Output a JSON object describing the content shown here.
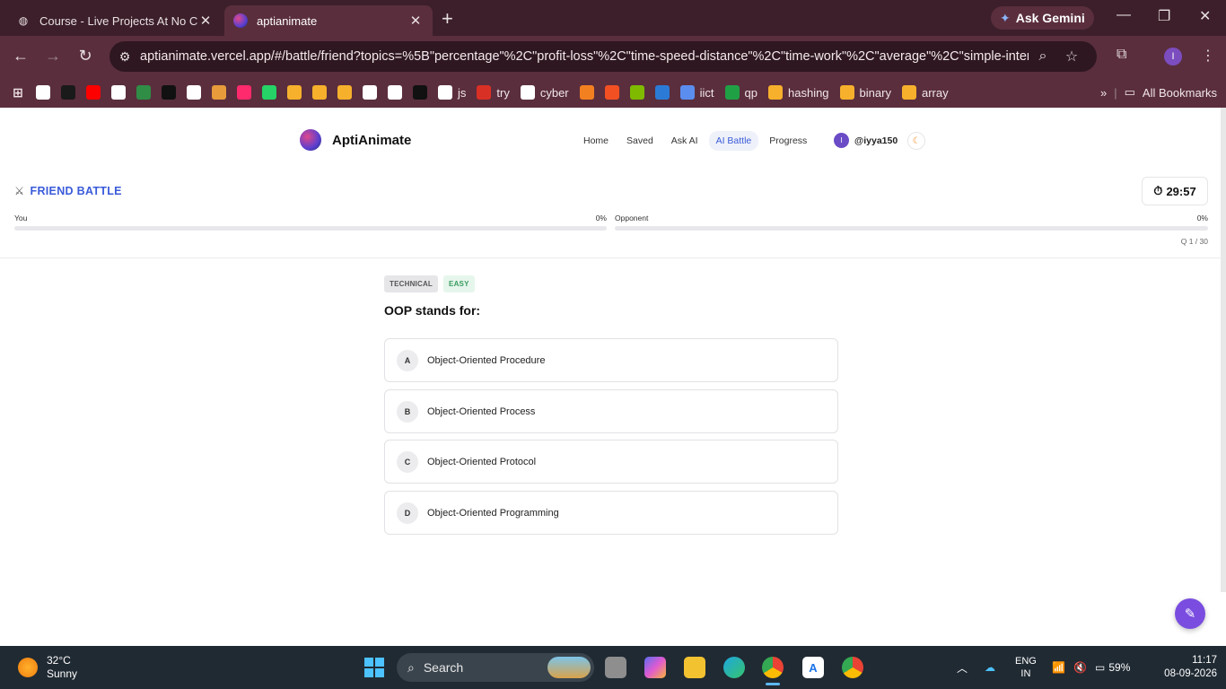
{
  "browser": {
    "tabs": [
      {
        "title": "Course - Live Projects At No Co",
        "active": false
      },
      {
        "title": "aptianimate",
        "active": true
      }
    ],
    "gemini_label": "Ask Gemini",
    "url": "aptianimate.vercel.app/#/battle/friend?topics=%5B\"percentage\"%2C\"profit-loss\"%2C\"time-speed-distance\"%2C\"time-work\"%2C\"average\"%2C\"simple-interest...",
    "bookmarks": [
      {
        "label": "",
        "icon": "openai-icon",
        "color": "#ffffff"
      },
      {
        "label": "",
        "icon": "codechef-icon",
        "color": "#1a1a1a"
      },
      {
        "label": "",
        "icon": "youtube-icon",
        "color": "#ff0000"
      },
      {
        "label": "",
        "icon": "site-icon",
        "color": "#ffffff"
      },
      {
        "label": "",
        "icon": "geeksforgeeks-icon",
        "color": "#2f8d46"
      },
      {
        "label": "",
        "icon": "hackerrank-icon",
        "color": "#111111"
      },
      {
        "label": "",
        "icon": "github-icon",
        "color": "#ffffff"
      },
      {
        "label": "",
        "icon": "fox-icon",
        "color": "#e89b3a"
      },
      {
        "label": "",
        "icon": "cube-icon",
        "color": "#ff2a6d"
      },
      {
        "label": "",
        "icon": "whatsapp-icon",
        "color": "#25d366"
      },
      {
        "label": "",
        "icon": "triangle-icon",
        "color": "#f6b02c"
      },
      {
        "label": "",
        "icon": "diamond-icon",
        "color": "#f6b02c"
      },
      {
        "label": "",
        "icon": "cc-icon",
        "color": "#f6b02c"
      },
      {
        "label": "",
        "icon": "cisco-icon",
        "color": "#ffffff"
      },
      {
        "label": "",
        "icon": "cisco-icon",
        "color": "#ffffff"
      },
      {
        "label": "",
        "icon": "circle-icon",
        "color": "#111111"
      },
      {
        "label": "js",
        "icon": "cisco-icon",
        "color": "#ffffff"
      },
      {
        "label": "try",
        "icon": "red-icon",
        "color": "#d93025"
      },
      {
        "label": "cyber",
        "icon": "cisco-icon",
        "color": "#ffffff"
      },
      {
        "label": "",
        "icon": "cloudflare-icon",
        "color": "#f38020"
      },
      {
        "label": "",
        "icon": "microsoft-icon",
        "color": "#f25022"
      },
      {
        "label": "",
        "icon": "microsoft-icon",
        "color": "#7fba00"
      },
      {
        "label": "",
        "icon": "play-icon",
        "color": "#2b7bd6"
      },
      {
        "label": "iict",
        "icon": "gear-icon",
        "color": "#5b8def"
      },
      {
        "label": "qp",
        "icon": "login-icon",
        "color": "#20a045"
      },
      {
        "label": "hashing",
        "icon": "cc-icon",
        "color": "#f6b02c"
      },
      {
        "label": "binary",
        "icon": "cc-icon",
        "color": "#f6b02c"
      },
      {
        "label": "array",
        "icon": "cc-icon",
        "color": "#f6b02c"
      }
    ],
    "all_bookmarks_label": "All Bookmarks"
  },
  "app": {
    "brand": "AptiAnimate",
    "nav": [
      {
        "label": "Home",
        "active": false
      },
      {
        "label": "Saved",
        "active": false
      },
      {
        "label": "Ask AI",
        "active": false
      },
      {
        "label": "AI Battle",
        "active": true
      },
      {
        "label": "Progress",
        "active": false
      }
    ],
    "user_initial": "I",
    "username": "@iyya150",
    "theme_icon": "moon-icon",
    "accent": "#3a5bd9"
  },
  "battle": {
    "title": "FRIEND BATTLE",
    "timer": "29:57",
    "you_label": "You",
    "you_pct_text": "0%",
    "you_progress": 0,
    "opponent_label": "Opponent",
    "opponent_pct_text": "0%",
    "opponent_progress": 0,
    "question_counter": "Q 1 / 30"
  },
  "question": {
    "category": "TECHNICAL",
    "difficulty": "EASY",
    "text": "OOP stands for:",
    "options": [
      {
        "letter": "A",
        "text": "Object-Oriented Procedure"
      },
      {
        "letter": "B",
        "text": "Object-Oriented Process"
      },
      {
        "letter": "C",
        "text": "Object-Oriented Protocol"
      },
      {
        "letter": "D",
        "text": "Object-Oriented Programming"
      }
    ]
  },
  "taskbar": {
    "temp": "32°C",
    "condition": "Sunny",
    "search_label": "Search",
    "lang_line1": "ENG",
    "lang_line2": "IN",
    "battery": "59%",
    "time": "11:17",
    "date": "08-09-2026"
  }
}
